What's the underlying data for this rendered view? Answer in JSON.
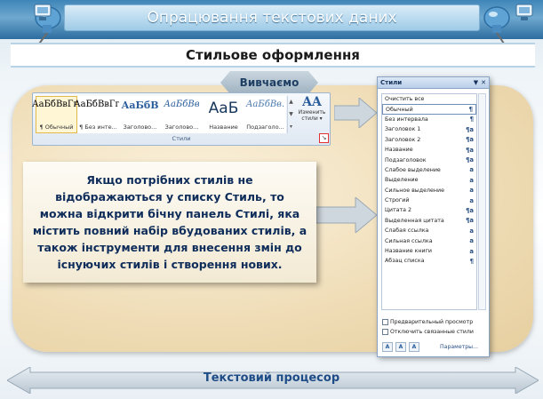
{
  "header": {
    "title": "Опрацювання текстових даних",
    "subtitle": "Стильове оформлення",
    "study_tab": "Вивчаємо"
  },
  "ribbon": {
    "gallery": [
      {
        "sample": "АаБбВвГг,",
        "label": "¶ Обычный",
        "selected": true
      },
      {
        "sample": "АаБбВвГг,",
        "label": "¶ Без инте..."
      },
      {
        "sample": "АаБбВ",
        "label": "Заголово..."
      },
      {
        "sample": "АаБбВв",
        "label": "Заголово..."
      },
      {
        "sample": "АаБ",
        "label": "Название"
      },
      {
        "sample": "АаБбВв.",
        "label": "Подзаголо..."
      }
    ],
    "change_styles_icon": "AA",
    "change_styles_label": "Изменить стили ▾",
    "group_label": "Стили",
    "launcher_icon": "dialog-launcher-icon"
  },
  "info_text": "Якщо  потрібних стилів не відображаються у списку Стиль, то можна відкрити бічну панель Стилі, яка містить повний набір вбудованих стилів, а також інструменти для внесення змін до існуючих стилів і створення нових.",
  "styles_pane": {
    "title": "Стили",
    "items": [
      {
        "name": "Очистить все",
        "mark": ""
      },
      {
        "name": "Обычный",
        "mark": "¶"
      },
      {
        "name": "Без интервала",
        "mark": "¶"
      },
      {
        "name": "Заголовок 1",
        "mark": "¶a"
      },
      {
        "name": "Заголовок 2",
        "mark": "¶a"
      },
      {
        "name": "Название",
        "mark": "¶a"
      },
      {
        "name": "Подзаголовок",
        "mark": "¶a"
      },
      {
        "name": "Слабое выделение",
        "mark": "a"
      },
      {
        "name": "Выделение",
        "mark": "a"
      },
      {
        "name": "Сильное выделение",
        "mark": "a"
      },
      {
        "name": "Строгий",
        "mark": "a"
      },
      {
        "name": "Цитата 2",
        "mark": "¶a"
      },
      {
        "name": "Выделенная цитата",
        "mark": "¶a"
      },
      {
        "name": "Слабая ссылка",
        "mark": "a"
      },
      {
        "name": "Сильная ссылка",
        "mark": "a"
      },
      {
        "name": "Название книги",
        "mark": "a"
      },
      {
        "name": "Абзац списка",
        "mark": "¶"
      }
    ],
    "preview_label": "Предварительный просмотр",
    "linked_label": "Отключить связанные стили",
    "options_link": "Параметры..."
  },
  "footer": {
    "label": "Текстовий процесор"
  }
}
